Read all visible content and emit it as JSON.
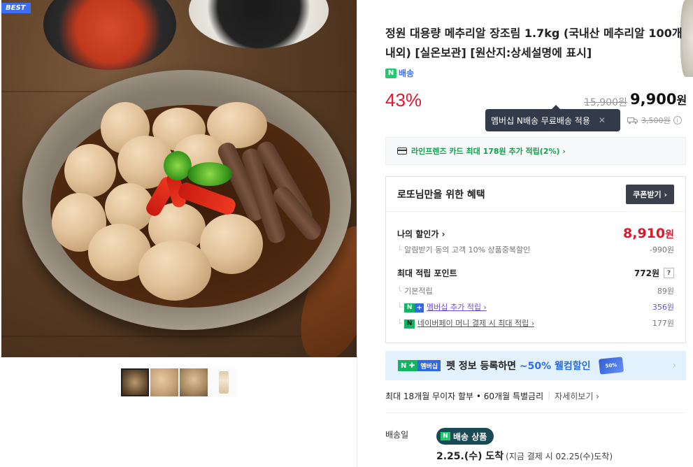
{
  "image": {
    "best_badge": "BEST",
    "thumbnails": [
      "thumb-1",
      "thumb-2",
      "thumb-3",
      "thumb-4"
    ]
  },
  "product": {
    "title": "정원 대용량 메추리알 장조림 1.7kg (국내산 메추리알 100개 내외) [실온보관] [원산지:상세설명에 표시]",
    "n_delivery_badge": "배송",
    "n_letter": "N",
    "discount_rate": "43%",
    "original_price": "15,900원",
    "sale_price_num": "9,900",
    "sale_price_unit": "원",
    "tooltip": "멤버십 N배송 무료배송 적용",
    "tooltip_close": "✕",
    "shipping_fee": "3,500원",
    "shipping_info": "i"
  },
  "card_promo": "라인프렌즈 카드 최대 178원 추가 적립(2%) ›",
  "benefit": {
    "title": "로또님만을 위한 혜택",
    "coupon_button": "쿠폰받기 ›",
    "my_price_label": "나의 할인가 ›",
    "my_price_num": "8,910",
    "my_price_unit": "원",
    "notify_label": "알림받기 동의 고객 10% 상품중복할인",
    "notify_value": "-990원",
    "max_points_label": "최대 적립 포인트",
    "max_points_value": "772원",
    "help_icon": "?",
    "base_points_label": "기본적립",
    "base_points_value": "89원",
    "membership_label": "멤버십 추가 적립 ›",
    "membership_value": "356원",
    "npay_label": "네이버페이 머니 결제 시 최대 적립 ›",
    "npay_value": "177원"
  },
  "pet_banner": {
    "badge_n": "N ✚",
    "badge_member": "멤버십",
    "text_pre": "펫 정보 등록하면 ",
    "text_hl": "~50% 웰컴할인",
    "coupon_label": "50%",
    "arrow": "›"
  },
  "installment": {
    "text": "최대 18개월 무이자 할부 • 60개월 특별금리",
    "sep": "|",
    "more": "자세히보기 ›"
  },
  "shipping": {
    "label": "배송일",
    "pill_n": "N",
    "pill_text": "배송 상품",
    "arrival_date": "2.25.(수) 도착",
    "arrival_note": "(지금 결제 시 02.25(수)도착)"
  }
}
